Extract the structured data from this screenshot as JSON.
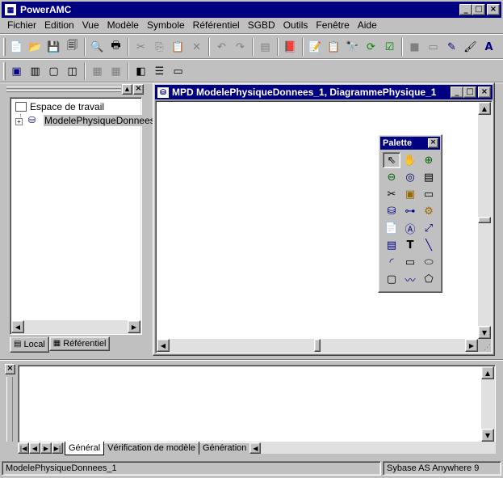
{
  "app": {
    "title": "PowerAMC"
  },
  "menu": [
    "Fichier",
    "Edition",
    "Vue",
    "Modèle",
    "Symbole",
    "Référentiel",
    "SGBD",
    "Outils",
    "Fenêtre",
    "Aide"
  ],
  "browser": {
    "root": "Espace de travail",
    "item": "ModelePhysiqueDonnees",
    "tabs": [
      "Local",
      "Référentiel"
    ]
  },
  "diagram": {
    "title": "MPD ModelePhysiqueDonnees_1, DiagrammePhysique_1"
  },
  "palette": {
    "title": "Palette"
  },
  "output": {
    "tabs": [
      "Général",
      "Vérification de modèle",
      "Génération"
    ]
  },
  "status": {
    "left": "ModelePhysiqueDonnees_1",
    "right": "Sybase AS Anywhere 9"
  },
  "colors": {
    "titlebar": "#000080",
    "face": "#c0c0c0"
  }
}
